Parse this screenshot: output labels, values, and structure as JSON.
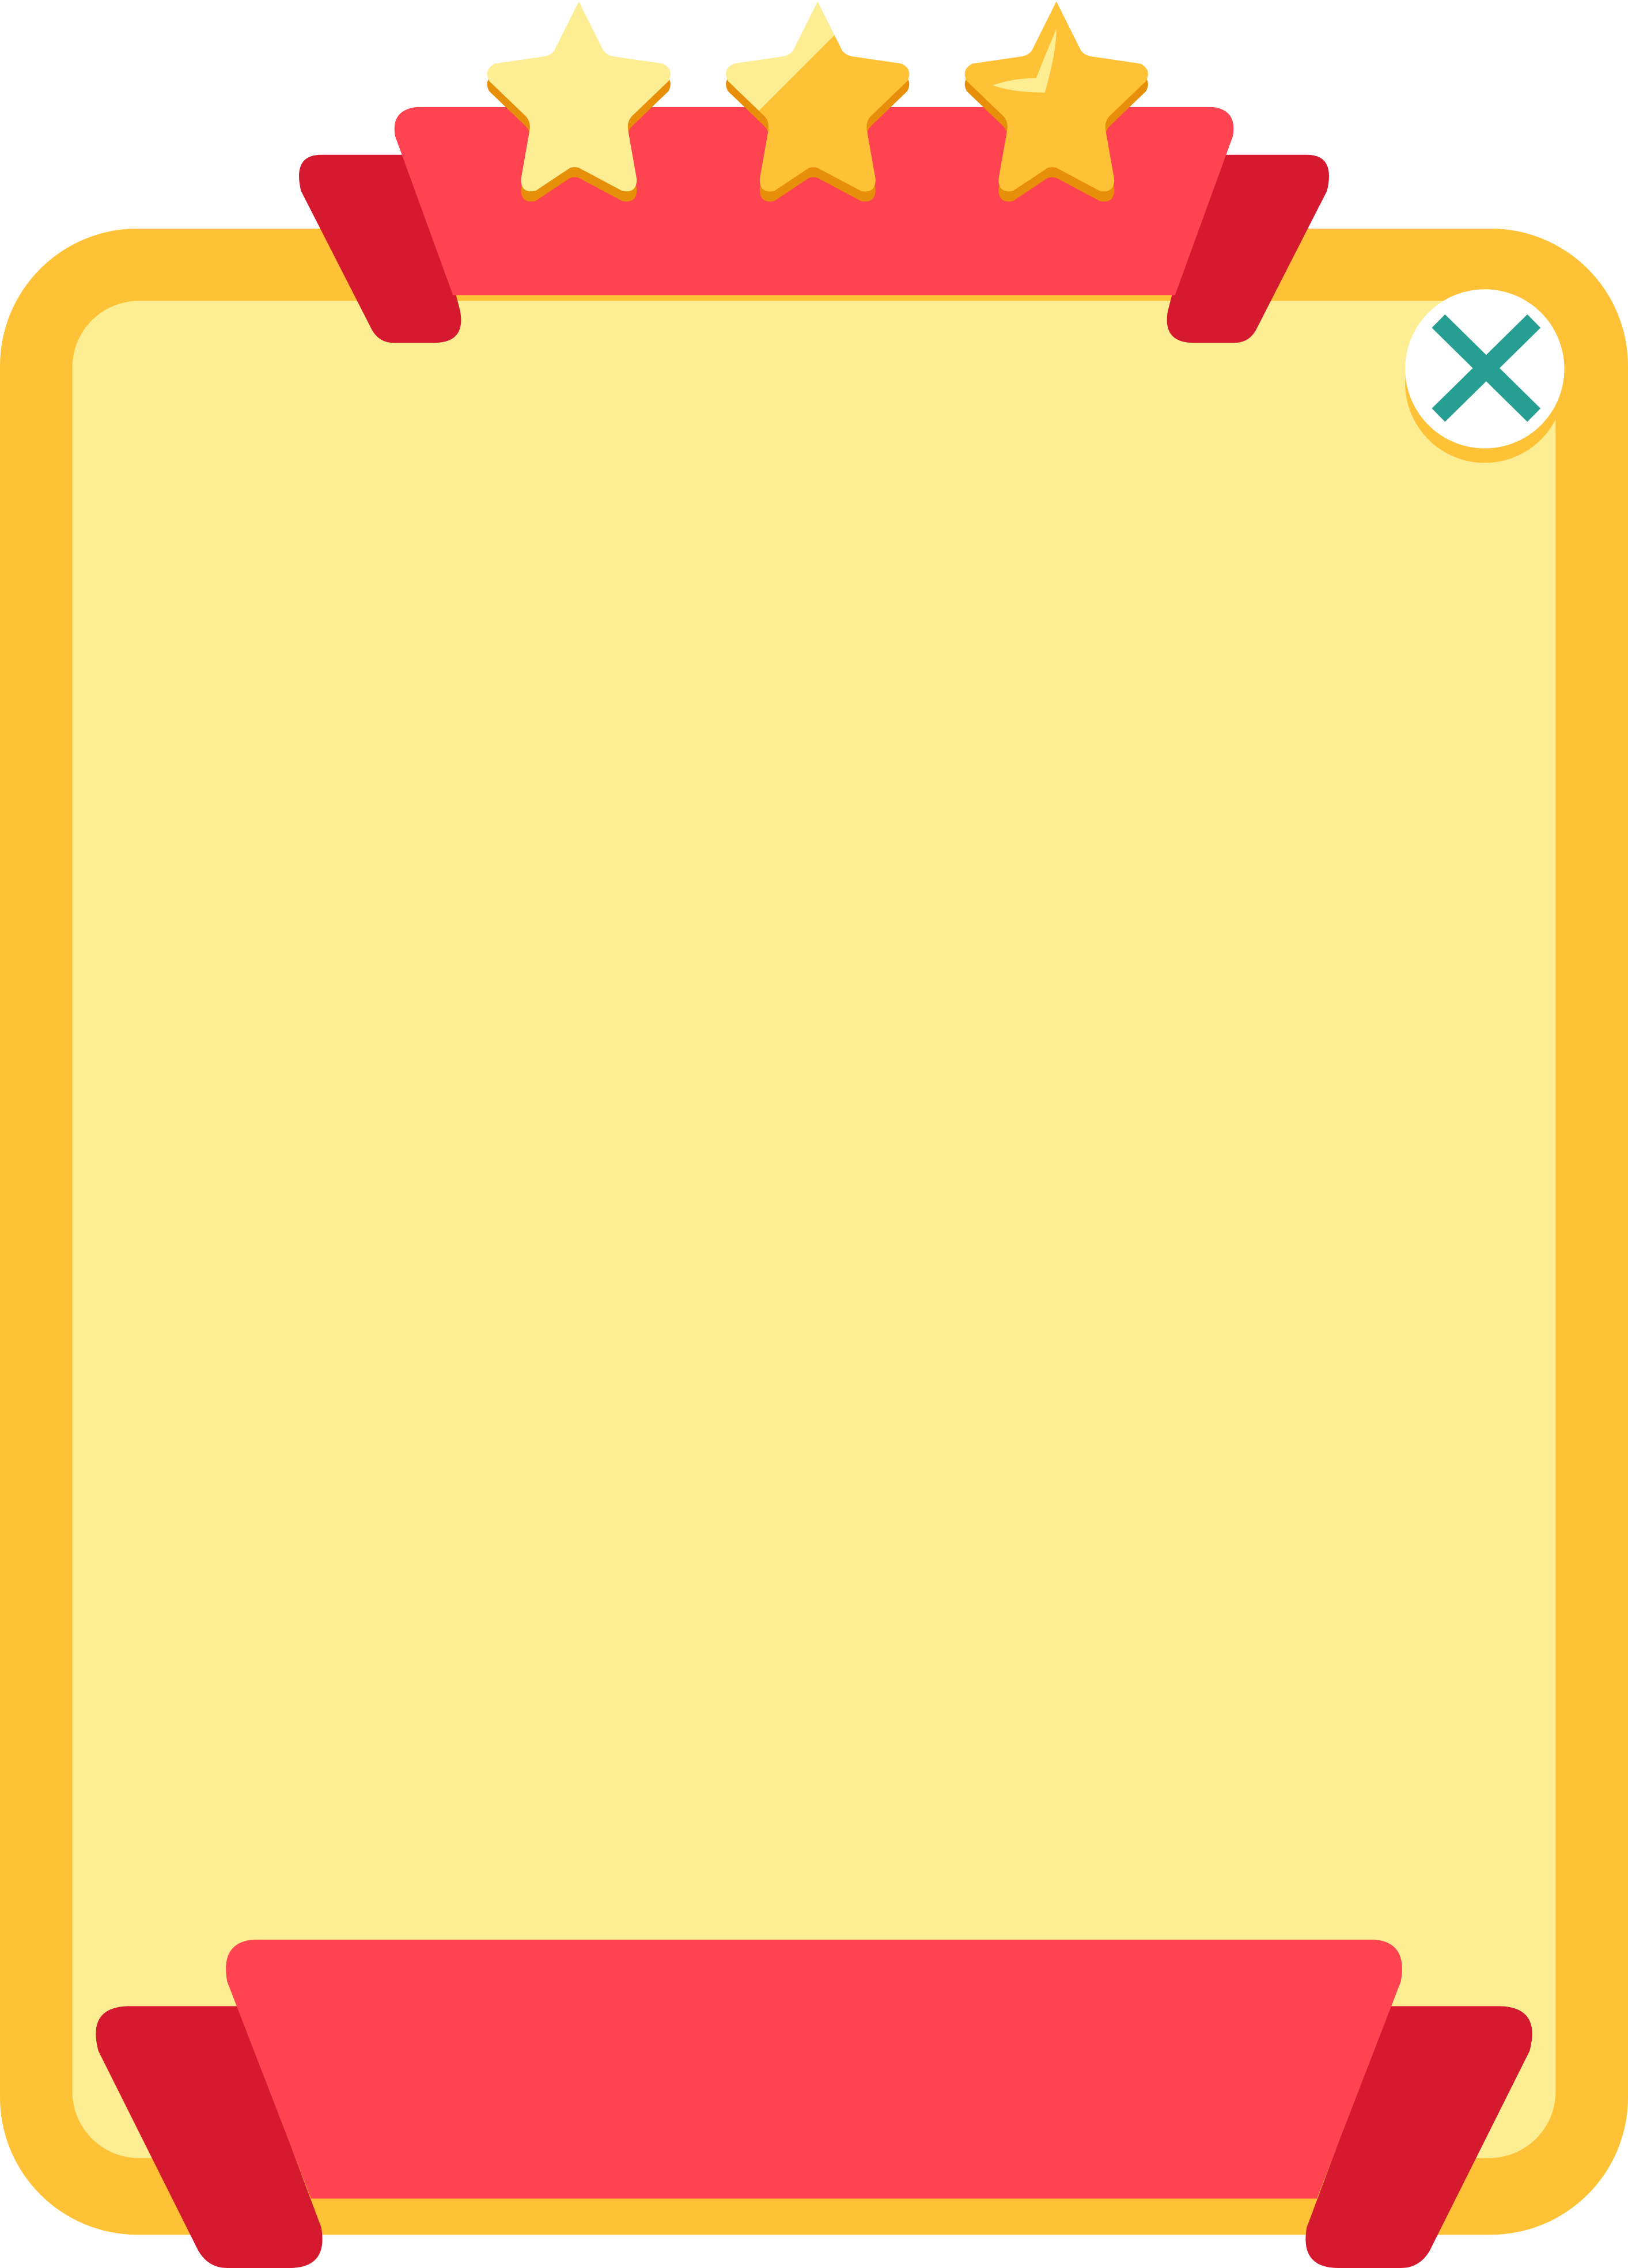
{
  "colors": {
    "frame": "#FFC135",
    "panel_fill": "#FDED93",
    "ribbon": "#FF4350",
    "ribbon_flap": "#D5192F",
    "star_light": "#FDED93",
    "star_filled": "#FFC135",
    "star_shadow": "#E88F0A",
    "close_bg": "#FFFFFF",
    "close_icon": "#279E92"
  },
  "rating": {
    "stars": [
      {
        "fill": 0
      },
      {
        "fill": 0.5
      },
      {
        "fill": 1
      }
    ]
  },
  "icons": {
    "close": "close-icon",
    "star": "star-icon"
  }
}
